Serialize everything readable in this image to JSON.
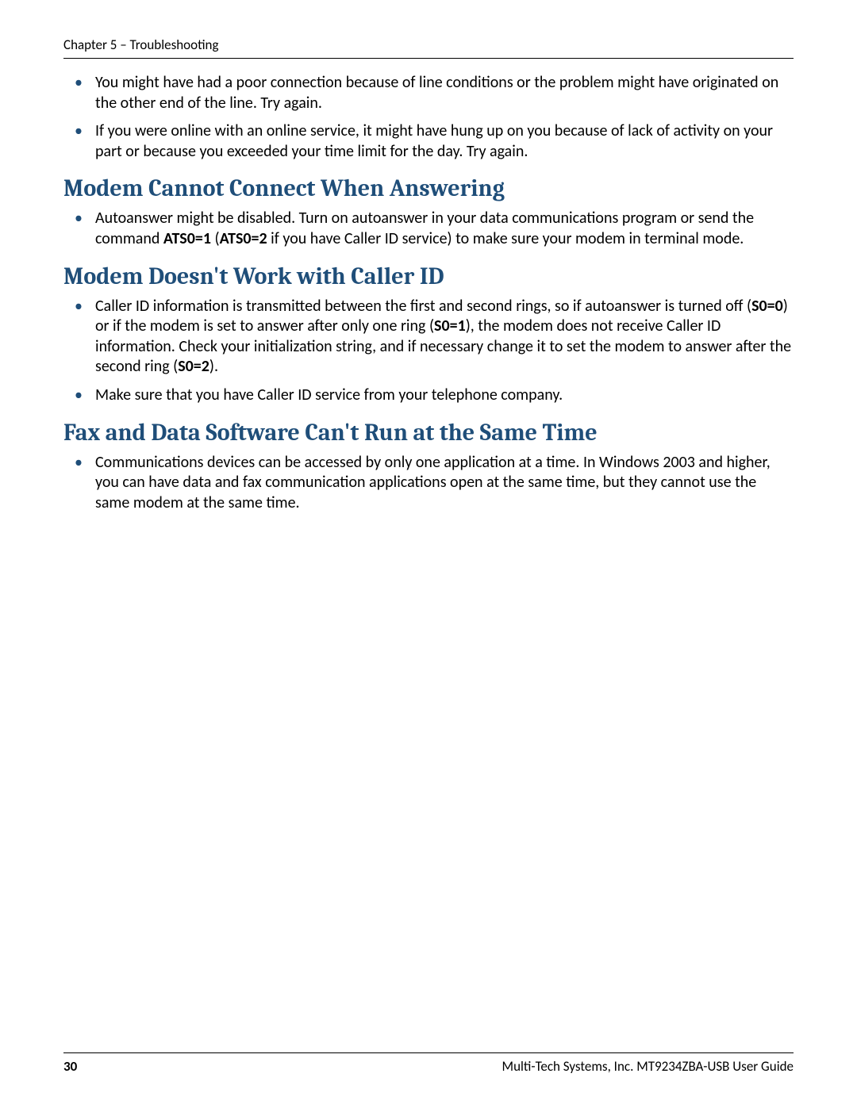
{
  "header": {
    "chapter": "Chapter 5 – Troubleshooting"
  },
  "intro_bullets": [
    {
      "text": "You might have had a poor connection because of line conditions or the problem might have originated on the other end of the line. Try again."
    },
    {
      "text": "If you were online with an online service, it might have hung up on you because of lack of activity on your part or because you exceeded your time limit for the day. Try again."
    }
  ],
  "sections": [
    {
      "title": "Modem Cannot Connect When Answering",
      "bullets": [
        {
          "frags": [
            {
              "t": "Autoanswer might be disabled. Turn on autoanswer in your data communications program or send the command "
            },
            {
              "t": "ATS0=1",
              "b": true
            },
            {
              "t": " ("
            },
            {
              "t": "ATS0=2",
              "b": true
            },
            {
              "t": " if you have Caller ID service) to make sure your modem in terminal mode."
            }
          ]
        }
      ]
    },
    {
      "title": "Modem Doesn't Work with Caller ID",
      "bullets": [
        {
          "frags": [
            {
              "t": "Caller ID information is transmitted between the first and second rings, so if autoanswer is turned off ("
            },
            {
              "t": "S0=0",
              "b": true
            },
            {
              "t": ") or if the modem is set to answer after only one ring ("
            },
            {
              "t": "S0=1",
              "b": true
            },
            {
              "t": "), the modem does not receive Caller ID information. Check your initialization string, and if necessary change it to set the modem to answer after the second ring ("
            },
            {
              "t": "S0=2",
              "b": true
            },
            {
              "t": ")."
            }
          ]
        },
        {
          "text": "Make sure that you have Caller ID service from your telephone company."
        }
      ]
    },
    {
      "title": "Fax and Data Software Can't Run at the Same Time",
      "bullets": [
        {
          "text": "Communications devices can be accessed by only one application at a time. In Windows 2003 and higher, you can have data and fax communication applications open at the same time, but they cannot use the same modem at the same time."
        }
      ]
    }
  ],
  "footer": {
    "page_number": "30",
    "guide": "Multi-Tech Systems, Inc. MT9234ZBA-USB User Guide"
  }
}
